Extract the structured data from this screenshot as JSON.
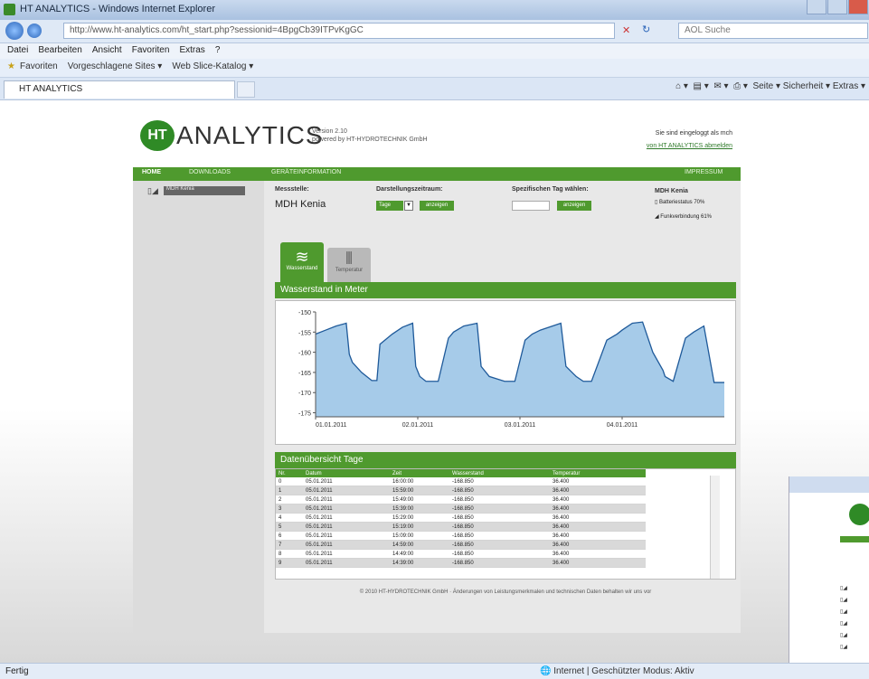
{
  "browser": {
    "window_title": "HT ANALYTICS - Windows Internet Explorer",
    "url": "http://www.ht-analytics.com/ht_start.php?sessionid=4BpgCb39ITPvKgGC",
    "url_domain": "ht-analytics.com",
    "search_placeholder": "AOL Suche",
    "menu": [
      "Datei",
      "Bearbeiten",
      "Ansicht",
      "Favoriten",
      "Extras",
      "?"
    ],
    "favorites": [
      "Favoriten",
      "Vorgeschlagene Sites ▾",
      "Web Slice-Katalog ▾"
    ],
    "tab_title": "HT ANALYTICS",
    "command_bar": "Seite ▾   Sicherheit ▾   Extras ▾",
    "status_left": "Fertig",
    "status_right": "Internet | Geschützter Modus: Aktiv"
  },
  "header": {
    "logo_mark": "HT",
    "logo_text": "ANALYTICS",
    "version_line1": "Version 2.10",
    "version_line2": "powered by HT-HYDROTECHNIK GmbH",
    "logged_in_line": "Sie sind eingeloggt als mch",
    "logout_link": "von HT ANALYTICS abmelden"
  },
  "nav": {
    "home": "HOME",
    "downloads": "DOWNLOADS",
    "device_info": "GERÄTEINFORMATION",
    "imprint": "IMPRESSUM"
  },
  "sidebar": {
    "site_item": "MDH Kenia"
  },
  "controls": {
    "station_label": "Messstelle:",
    "station_value": "MDH Kenia",
    "period_label": "Darstellungszeitraum:",
    "period_selected": "Tage",
    "show_button": "anzeigen",
    "day_label": "Spezifischen Tag wählen:",
    "day_input": "",
    "show_button2": "anzeigen",
    "status_title": "MDH Kenia",
    "battery": "Batteriestatus 70%",
    "radio": "Funkverbindung 61%"
  },
  "icon_tabs": [
    {
      "label": "Wasserstand",
      "icon": "water-level-icon",
      "active": true
    },
    {
      "label": "Temperatur",
      "icon": "temperature-icon",
      "active": false
    }
  ],
  "chart_section_title": "Wasserstand in Meter",
  "colors": {
    "brand_green": "#4f9a2e",
    "chart_fill": "#a6cbe9",
    "chart_line": "#1f5a9a"
  },
  "chart_data": {
    "type": "area",
    "title": "",
    "xlabel": "",
    "ylabel": "",
    "ylim": [
      -176,
      -150
    ],
    "yticks": [
      -150,
      -155,
      -160,
      -165,
      -170,
      -175
    ],
    "ytick_labels": [
      "-150",
      "-155",
      "-160",
      "-165",
      "-170",
      "-175"
    ],
    "xtick_labels": [
      "01.01.2011",
      "02.01.2011",
      "03.01.2011",
      "04.01.2011"
    ],
    "x_days": [
      0,
      1,
      2,
      3
    ],
    "x_range_days": [
      0,
      4.0
    ],
    "series": [
      {
        "x": [
          0.0,
          0.1,
          0.2,
          0.3,
          0.33,
          0.36,
          0.45,
          0.55,
          0.6,
          0.63,
          0.75,
          0.85,
          0.95,
          0.98,
          1.02,
          1.08,
          1.2,
          1.3,
          1.35,
          1.45,
          1.58,
          1.62,
          1.7,
          1.85,
          1.95,
          2.05,
          2.12,
          2.2,
          2.4,
          2.45,
          2.55,
          2.62,
          2.7,
          2.85,
          2.95,
          3.0,
          3.1,
          3.2,
          3.3,
          3.4,
          3.42,
          3.5,
          3.62,
          3.7,
          3.8,
          3.9,
          4.0
        ],
        "y": [
          -155.5,
          -154.5,
          -153.5,
          -152.8,
          -160.5,
          -162.5,
          -165.0,
          -167.0,
          -167.0,
          -158.0,
          -155.5,
          -153.8,
          -152.8,
          -163.5,
          -166.0,
          -167.2,
          -167.2,
          -156.5,
          -155.0,
          -153.5,
          -152.8,
          -163.5,
          -166.0,
          -167.2,
          -167.2,
          -157.0,
          -155.5,
          -154.5,
          -152.8,
          -163.5,
          -166.0,
          -167.2,
          -167.2,
          -157.0,
          -155.5,
          -154.5,
          -152.8,
          -152.5,
          -160.0,
          -164.5,
          -166.0,
          -167.2,
          -156.5,
          -155.0,
          -153.5,
          -167.5,
          -167.5
        ]
      }
    ],
    "grid": false,
    "legend": "none"
  },
  "table_section_title": "Datenübersicht Tage",
  "table": {
    "columns": [
      "Nr.",
      "Datum",
      "Zeit",
      "Wasserstand",
      "Temperatur"
    ],
    "rows": [
      [
        "0",
        "05.01.2011",
        "16:00:00",
        "-168.850",
        "36.400"
      ],
      [
        "1",
        "05.01.2011",
        "15:59:00",
        "-168.850",
        "36.400"
      ],
      [
        "2",
        "05.01.2011",
        "15:49:00",
        "-168.850",
        "36.400"
      ],
      [
        "3",
        "05.01.2011",
        "15:39:00",
        "-168.850",
        "36.400"
      ],
      [
        "4",
        "05.01.2011",
        "15:29:00",
        "-168.850",
        "36.400"
      ],
      [
        "5",
        "05.01.2011",
        "15:19:00",
        "-168.850",
        "36.400"
      ],
      [
        "6",
        "05.01.2011",
        "15:09:00",
        "-168.850",
        "36.400"
      ],
      [
        "7",
        "05.01.2011",
        "14:59:00",
        "-168.850",
        "36.400"
      ],
      [
        "8",
        "05.01.2011",
        "14:49:00",
        "-168.850",
        "36.400"
      ],
      [
        "9",
        "05.01.2011",
        "14:39:00",
        "-168.850",
        "36.400"
      ]
    ]
  },
  "footer": "© 2010 HT-HYDROTECHNIK GmbH · Änderungen von Leistungsmerkmalen und technischen Daten behalten wir uns vor"
}
